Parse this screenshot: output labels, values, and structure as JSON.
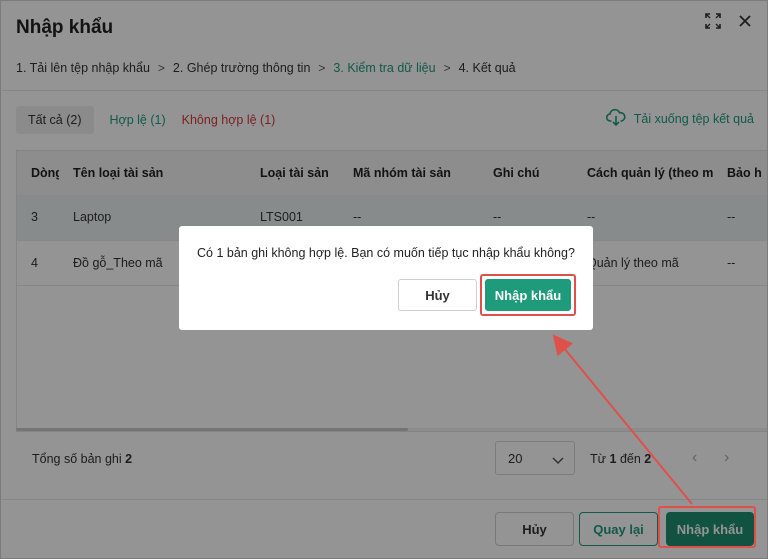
{
  "dialog": {
    "title": "Nhập khẩu"
  },
  "steps": [
    "1. Tải lên tệp nhập khẩu",
    "2. Ghép trường thông tin",
    "3. Kiểm tra dữ liệu",
    "4. Kết quả"
  ],
  "tabs": {
    "all": "Tất cả (2)",
    "valid": "Hợp lệ (1)",
    "invalid": "Không hợp lệ (1)"
  },
  "download_label": "Tải xuống tệp kết quả",
  "table": {
    "headers": [
      "Dòng",
      "Tên loại tài sản",
      "Loại tài sản",
      "Mã nhóm tài sản",
      "Ghi chú",
      "Cách quản lý (theo mã",
      "Bảo h"
    ],
    "rows": [
      [
        "3",
        "Laptop",
        "LTS001",
        "--",
        "--",
        "--",
        "--"
      ],
      [
        "4",
        "Đồ gỗ_Theo mã",
        "",
        "",
        "",
        "Quản lý theo mã",
        "--"
      ]
    ]
  },
  "footer": {
    "total_label": "Tổng số bản ghi",
    "total_value": "2",
    "page_size": "20",
    "range_from_label": "Từ",
    "range_from": "1",
    "range_to_label": "đến",
    "range_to": "2"
  },
  "buttons": {
    "cancel": "Hủy",
    "back": "Quay lại",
    "import": "Nhập khẩu"
  },
  "confirm": {
    "message": "Có 1 bản ghi không hợp lệ. Bạn có muốn tiếp tục nhập khẩu không?",
    "cancel": "Hủy",
    "ok": "Nhập khẩu"
  },
  "colors": {
    "accent": "#1e9b7a",
    "danger": "#d43a3a",
    "highlight": "#e0504a"
  },
  "icons": [
    "expand-icon",
    "close-icon",
    "chevron-right-icon",
    "cloud-download-icon",
    "chevron-down-icon",
    "chevron-left-icon"
  ]
}
